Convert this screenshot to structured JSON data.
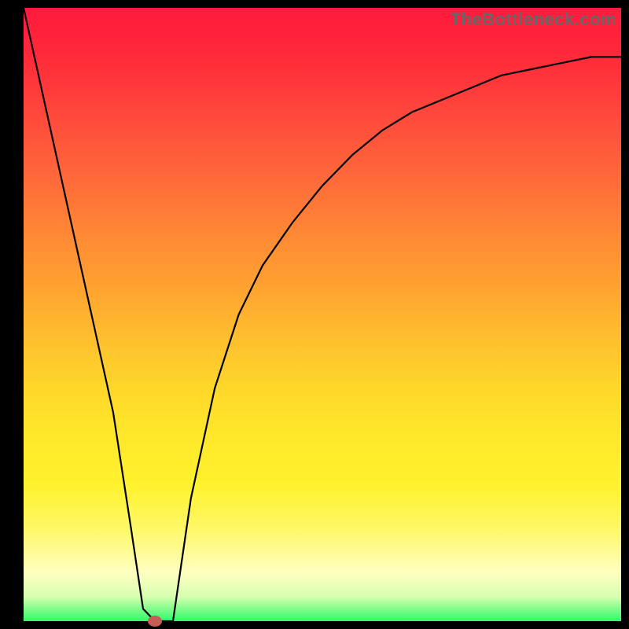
{
  "watermark": "TheBottleneck.com",
  "chart_data": {
    "type": "line",
    "title": "",
    "xlabel": "",
    "ylabel": "",
    "xlim": [
      0,
      100
    ],
    "ylim": [
      0,
      100
    ],
    "grid": false,
    "legend": false,
    "background": "rainbow-vertical-gradient",
    "background_stops": [
      {
        "pos": 0,
        "color": "#ff1a3c"
      },
      {
        "pos": 50,
        "color": "#ffbf2e"
      },
      {
        "pos": 85,
        "color": "#fff868"
      },
      {
        "pos": 100,
        "color": "#2cfb6a"
      }
    ],
    "series": [
      {
        "name": "bottleneck-curve",
        "color": "#000000",
        "x": [
          0,
          5,
          10,
          15,
          18,
          20,
          22,
          25,
          28,
          32,
          36,
          40,
          45,
          50,
          55,
          60,
          65,
          70,
          75,
          80,
          85,
          90,
          95,
          100
        ],
        "y": [
          100,
          78,
          56,
          34,
          15,
          2,
          0,
          0,
          20,
          38,
          50,
          58,
          65,
          71,
          76,
          80,
          83,
          85,
          87,
          89,
          90,
          91,
          92,
          92
        ]
      }
    ],
    "marker": {
      "name": "optimal-point",
      "x": 22,
      "y": 0,
      "color": "#c55e55"
    }
  }
}
